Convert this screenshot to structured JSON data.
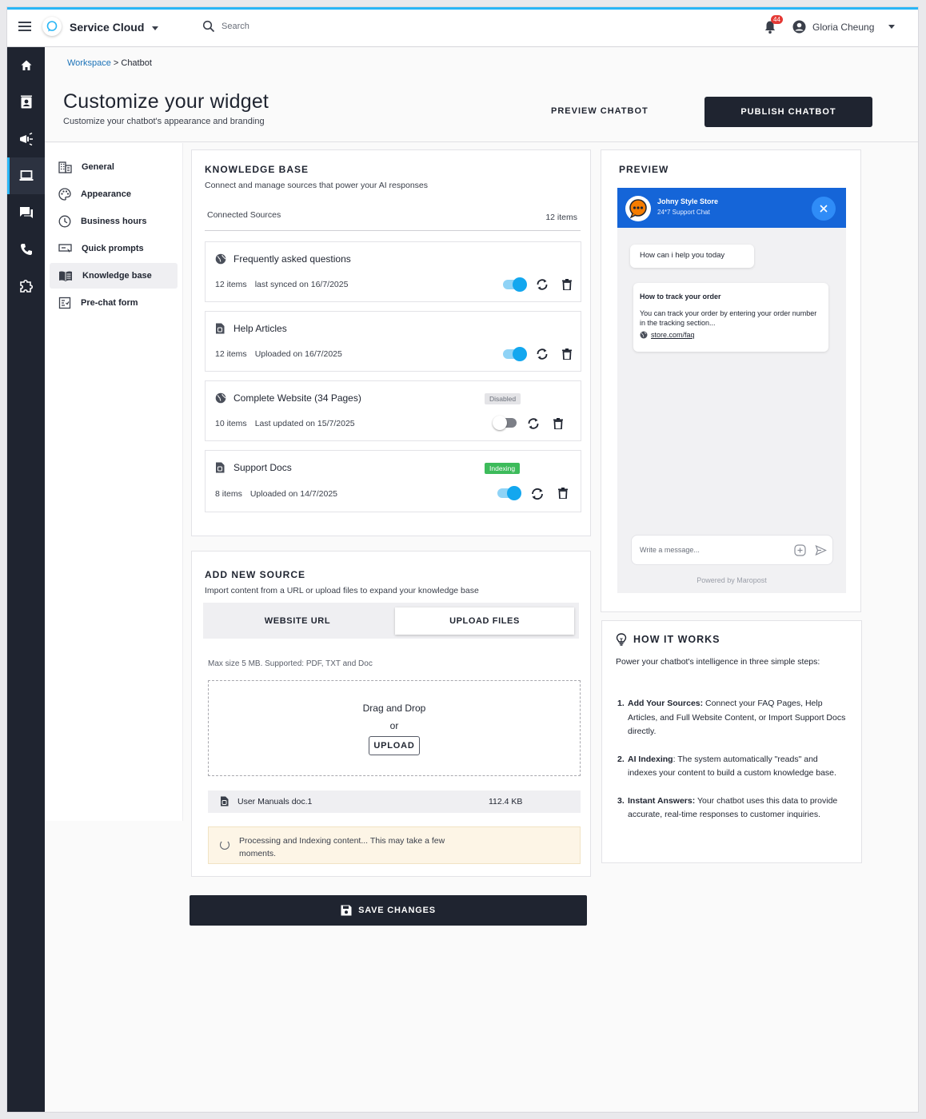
{
  "app": {
    "name": "Service Cloud",
    "search_placeholder": "Search",
    "notifications_count": "44",
    "user_name": "Gloria Cheung",
    "accent_color": "#29b6f6",
    "brand_dark": "#1f2430"
  },
  "breadcrumb": {
    "parent": "Workspace",
    "separator": " > ",
    "current": "Chatbot"
  },
  "header": {
    "title": "Customize your widget",
    "subtitle": "Customize your chatbot's appearance and branding",
    "preview_label": "PREVIEW CHATBOT",
    "publish_label": "PUBLISH CHATBOT"
  },
  "rail_icons": [
    "home-icon",
    "contacts-icon",
    "campaign-icon",
    "laptop-icon",
    "chat-icon",
    "phone-icon",
    "extension-icon"
  ],
  "sidenav": {
    "items": [
      {
        "label": "General",
        "icon": "building-icon"
      },
      {
        "label": "Appearance",
        "icon": "palette-icon"
      },
      {
        "label": "Business hours",
        "icon": "clock-icon"
      },
      {
        "label": "Quick prompts",
        "icon": "prompt-icon"
      },
      {
        "label": "Knowledge base",
        "icon": "book-icon",
        "active": true
      },
      {
        "label": "Pre-chat form",
        "icon": "form-icon"
      }
    ]
  },
  "knowledge_base": {
    "title": "KNOWLEDGE BASE",
    "subtitle": "Connect and manage sources that power your AI responses",
    "connected_label": "Connected Sources",
    "connected_count": "12 items",
    "sources": [
      {
        "name": "Frequently asked questions",
        "icon": "globe-icon",
        "items": "12 items",
        "date": "last synced on 16/7/2025",
        "enabled": true,
        "tag": ""
      },
      {
        "name": "Help Articles",
        "icon": "document-icon",
        "items": "12 items",
        "date": "Uploaded on 16/7/2025",
        "enabled": true,
        "tag": ""
      },
      {
        "name": "Complete Website (34 Pages)",
        "icon": "globe-icon",
        "items": "10 items",
        "date": "Last updated on 15/7/2025",
        "enabled": false,
        "tag": "Disabled"
      },
      {
        "name": "Support Docs",
        "icon": "document-icon",
        "items": "8 items",
        "date": "Uploaded on 14/7/2025",
        "enabled": true,
        "tag": "Indexing"
      }
    ]
  },
  "add_source": {
    "title": "ADD NEW SOURCE",
    "subtitle": "Import content from a URL or upload files to expand your knowledge base",
    "tab_url": "WEBSITE URL",
    "tab_upload": "UPLOAD FILES",
    "max_size": "Max size 5 MB. Supported:  PDF, TXT and Doc",
    "drag_text": "Drag and Drop",
    "or_text": "or",
    "upload_label": "UPLOAD",
    "file_name": "User Manuals doc.1",
    "file_size": "112.4 KB",
    "processing_text": "Processing and Indexing content... This may take a few moments."
  },
  "save_label": "SAVE CHANGES",
  "preview": {
    "title": "PREVIEW",
    "store_name": "Johny Style Store",
    "store_status": "24*7 Support Chat",
    "greeting": "How can i help you today",
    "answer_title": "How to track your order",
    "answer_body": "You can track your order by entering your order number in the tracking section...",
    "answer_link": "store.com/faq",
    "message_placeholder": "Write a message...",
    "powered_by": "Powered by Maropost",
    "header_color": "#1565d8"
  },
  "how_it_works": {
    "title": "HOW IT WORKS",
    "intro": "Power your chatbot's intelligence in three simple steps:",
    "steps": [
      {
        "num": "1.",
        "bold": "Add Your Sources:",
        "text": " Connect your FAQ Pages, Help Articles, and Full Website Content, or Import Support Docs directly."
      },
      {
        "num": "2.",
        "bold": "AI Indexing",
        "text": ": The system automatically \"reads\" and indexes your content to build a custom knowledge base."
      },
      {
        "num": "3.",
        "bold": "Instant Answers:",
        "text": " Your chatbot uses this data to provide accurate, real-time responses to customer inquiries."
      }
    ]
  }
}
